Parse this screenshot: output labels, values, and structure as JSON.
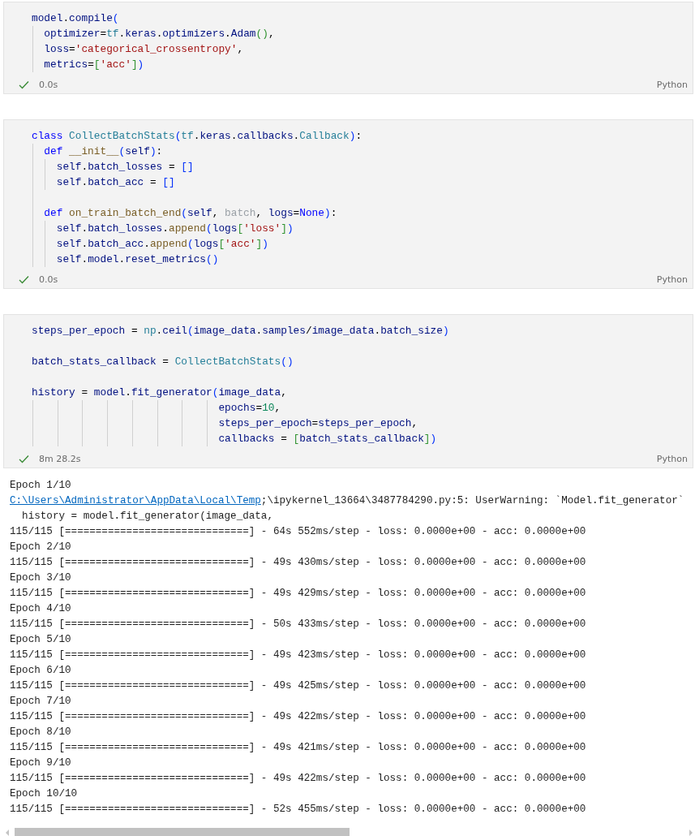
{
  "cells": [
    {
      "lines": [
        {
          "kind": "code",
          "tokens": [
            {
              "kind": "var",
              "text": "model"
            },
            {
              "kind": "plain",
              "text": "."
            },
            {
              "kind": "var",
              "text": "compile"
            },
            {
              "kind": "br1",
              "text": "("
            }
          ]
        },
        {
          "kind": "code",
          "tokens": [
            {
              "kind": "var",
              "text": "  optimizer"
            },
            {
              "kind": "plain",
              "text": "="
            },
            {
              "kind": "cls",
              "text": "tf"
            },
            {
              "kind": "plain",
              "text": "."
            },
            {
              "kind": "var",
              "text": "keras"
            },
            {
              "kind": "plain",
              "text": "."
            },
            {
              "kind": "var",
              "text": "optimizers"
            },
            {
              "kind": "plain",
              "text": "."
            },
            {
              "kind": "var",
              "text": "Adam"
            },
            {
              "kind": "br2",
              "text": "()"
            },
            {
              "kind": "plain",
              "text": ","
            }
          ]
        },
        {
          "kind": "code",
          "tokens": [
            {
              "kind": "var",
              "text": "  loss"
            },
            {
              "kind": "plain",
              "text": "="
            },
            {
              "kind": "str",
              "text": "'categorical_crossentropy'"
            },
            {
              "kind": "plain",
              "text": ","
            }
          ]
        },
        {
          "kind": "code",
          "tokens": [
            {
              "kind": "var",
              "text": "  metrics"
            },
            {
              "kind": "plain",
              "text": "="
            },
            {
              "kind": "br2",
              "text": "["
            },
            {
              "kind": "str",
              "text": "'acc'"
            },
            {
              "kind": "br2",
              "text": "]"
            },
            {
              "kind": "br1",
              "text": ")"
            }
          ]
        }
      ],
      "status": {
        "success": true,
        "time": "0.0s",
        "language": "Python"
      }
    },
    {
      "lines": [
        {
          "kind": "code",
          "tokens": [
            {
              "kind": "kw",
              "text": "class "
            },
            {
              "kind": "cls",
              "text": "CollectBatchStats"
            },
            {
              "kind": "br1",
              "text": "("
            },
            {
              "kind": "cls",
              "text": "tf"
            },
            {
              "kind": "plain",
              "text": "."
            },
            {
              "kind": "var",
              "text": "keras"
            },
            {
              "kind": "plain",
              "text": "."
            },
            {
              "kind": "var",
              "text": "callbacks"
            },
            {
              "kind": "plain",
              "text": "."
            },
            {
              "kind": "cls",
              "text": "Callback"
            },
            {
              "kind": "br1",
              "text": ")"
            },
            {
              "kind": "plain",
              "text": ":"
            }
          ]
        },
        {
          "kind": "code",
          "tokens": [
            {
              "kind": "kw",
              "text": "  def "
            },
            {
              "kind": "fn",
              "text": "__init__"
            },
            {
              "kind": "br1",
              "text": "("
            },
            {
              "kind": "var",
              "text": "self"
            },
            {
              "kind": "br1",
              "text": ")"
            },
            {
              "kind": "plain",
              "text": ":"
            }
          ]
        },
        {
          "kind": "code",
          "tokens": [
            {
              "kind": "var",
              "text": "    self"
            },
            {
              "kind": "plain",
              "text": "."
            },
            {
              "kind": "var",
              "text": "batch_losses"
            },
            {
              "kind": "plain",
              "text": " = "
            },
            {
              "kind": "br1",
              "text": "[]"
            }
          ]
        },
        {
          "kind": "code",
          "tokens": [
            {
              "kind": "var",
              "text": "    self"
            },
            {
              "kind": "plain",
              "text": "."
            },
            {
              "kind": "var",
              "text": "batch_acc"
            },
            {
              "kind": "plain",
              "text": " = "
            },
            {
              "kind": "br1",
              "text": "[]"
            }
          ]
        },
        {
          "kind": "blank"
        },
        {
          "kind": "code",
          "tokens": [
            {
              "kind": "kw",
              "text": "  def "
            },
            {
              "kind": "fn",
              "text": "on_train_batch_end"
            },
            {
              "kind": "br1",
              "text": "("
            },
            {
              "kind": "var",
              "text": "self"
            },
            {
              "kind": "plain",
              "text": ", "
            },
            {
              "kind": "unused",
              "text": "batch"
            },
            {
              "kind": "plain",
              "text": ", "
            },
            {
              "kind": "var",
              "text": "logs"
            },
            {
              "kind": "plain",
              "text": "="
            },
            {
              "kind": "kw",
              "text": "None"
            },
            {
              "kind": "br1",
              "text": ")"
            },
            {
              "kind": "plain",
              "text": ":"
            }
          ]
        },
        {
          "kind": "code",
          "tokens": [
            {
              "kind": "var",
              "text": "    self"
            },
            {
              "kind": "plain",
              "text": "."
            },
            {
              "kind": "var",
              "text": "batch_losses"
            },
            {
              "kind": "plain",
              "text": "."
            },
            {
              "kind": "fn",
              "text": "append"
            },
            {
              "kind": "br1",
              "text": "("
            },
            {
              "kind": "var",
              "text": "logs"
            },
            {
              "kind": "br2",
              "text": "["
            },
            {
              "kind": "str",
              "text": "'loss'"
            },
            {
              "kind": "br2",
              "text": "]"
            },
            {
              "kind": "br1",
              "text": ")"
            }
          ]
        },
        {
          "kind": "code",
          "tokens": [
            {
              "kind": "var",
              "text": "    self"
            },
            {
              "kind": "plain",
              "text": "."
            },
            {
              "kind": "var",
              "text": "batch_acc"
            },
            {
              "kind": "plain",
              "text": "."
            },
            {
              "kind": "fn",
              "text": "append"
            },
            {
              "kind": "br1",
              "text": "("
            },
            {
              "kind": "var",
              "text": "logs"
            },
            {
              "kind": "br2",
              "text": "["
            },
            {
              "kind": "str",
              "text": "'acc'"
            },
            {
              "kind": "br2",
              "text": "]"
            },
            {
              "kind": "br1",
              "text": ")"
            }
          ]
        },
        {
          "kind": "code",
          "tokens": [
            {
              "kind": "var",
              "text": "    self"
            },
            {
              "kind": "plain",
              "text": "."
            },
            {
              "kind": "var",
              "text": "model"
            },
            {
              "kind": "plain",
              "text": "."
            },
            {
              "kind": "var",
              "text": "reset_metrics"
            },
            {
              "kind": "br1",
              "text": "()"
            }
          ]
        }
      ],
      "status": {
        "success": true,
        "time": "0.0s",
        "language": "Python"
      }
    },
    {
      "lines": [
        {
          "kind": "code",
          "tokens": [
            {
              "kind": "var",
              "text": "steps_per_epoch"
            },
            {
              "kind": "plain",
              "text": " = "
            },
            {
              "kind": "cls",
              "text": "np"
            },
            {
              "kind": "plain",
              "text": "."
            },
            {
              "kind": "var",
              "text": "ceil"
            },
            {
              "kind": "br1",
              "text": "("
            },
            {
              "kind": "var",
              "text": "image_data"
            },
            {
              "kind": "plain",
              "text": "."
            },
            {
              "kind": "var",
              "text": "samples"
            },
            {
              "kind": "plain",
              "text": "/"
            },
            {
              "kind": "var",
              "text": "image_data"
            },
            {
              "kind": "plain",
              "text": "."
            },
            {
              "kind": "var",
              "text": "batch_size"
            },
            {
              "kind": "br1",
              "text": ")"
            }
          ]
        },
        {
          "kind": "blank"
        },
        {
          "kind": "code",
          "tokens": [
            {
              "kind": "var",
              "text": "batch_stats_callback"
            },
            {
              "kind": "plain",
              "text": " = "
            },
            {
              "kind": "cls",
              "text": "CollectBatchStats"
            },
            {
              "kind": "br1",
              "text": "()"
            }
          ]
        },
        {
          "kind": "blank"
        },
        {
          "kind": "code",
          "tokens": [
            {
              "kind": "var",
              "text": "history"
            },
            {
              "kind": "plain",
              "text": " = "
            },
            {
              "kind": "var",
              "text": "model"
            },
            {
              "kind": "plain",
              "text": "."
            },
            {
              "kind": "var",
              "text": "fit_generator"
            },
            {
              "kind": "br1",
              "text": "("
            },
            {
              "kind": "var",
              "text": "image_data"
            },
            {
              "kind": "plain",
              "text": ","
            }
          ]
        },
        {
          "kind": "code",
          "tokens": [
            {
              "kind": "var",
              "text": "                              epochs"
            },
            {
              "kind": "plain",
              "text": "="
            },
            {
              "kind": "num",
              "text": "10"
            },
            {
              "kind": "plain",
              "text": ","
            }
          ]
        },
        {
          "kind": "code",
          "tokens": [
            {
              "kind": "var",
              "text": "                              steps_per_epoch"
            },
            {
              "kind": "plain",
              "text": "="
            },
            {
              "kind": "var",
              "text": "steps_per_epoch"
            },
            {
              "kind": "plain",
              "text": ","
            }
          ]
        },
        {
          "kind": "code",
          "tokens": [
            {
              "kind": "var",
              "text": "                              callbacks"
            },
            {
              "kind": "plain",
              "text": " = "
            },
            {
              "kind": "br2",
              "text": "["
            },
            {
              "kind": "var",
              "text": "batch_stats_callback"
            },
            {
              "kind": "br2",
              "text": "]"
            },
            {
              "kind": "br1",
              "text": ")"
            }
          ]
        }
      ],
      "status": {
        "success": true,
        "time": "8m 28.2s",
        "language": "Python"
      },
      "output": [
        {
          "text": "Epoch 1/10"
        },
        {
          "link": "C:\\Users\\Administrator\\AppData\\Local\\Temp",
          "text": ";\\ipykernel_13664\\3487784290.py:5: UserWarning: `Model.fit_generator`"
        },
        {
          "text": "  history = model.fit_generator(image_data,"
        },
        {
          "text": "115/115 [==============================] - 64s 552ms/step - loss: 0.0000e+00 - acc: 0.0000e+00"
        },
        {
          "text": "Epoch 2/10"
        },
        {
          "text": "115/115 [==============================] - 49s 430ms/step - loss: 0.0000e+00 - acc: 0.0000e+00"
        },
        {
          "text": "Epoch 3/10"
        },
        {
          "text": "115/115 [==============================] - 49s 429ms/step - loss: 0.0000e+00 - acc: 0.0000e+00"
        },
        {
          "text": "Epoch 4/10"
        },
        {
          "text": "115/115 [==============================] - 50s 433ms/step - loss: 0.0000e+00 - acc: 0.0000e+00"
        },
        {
          "text": "Epoch 5/10"
        },
        {
          "text": "115/115 [==============================] - 49s 423ms/step - loss: 0.0000e+00 - acc: 0.0000e+00"
        },
        {
          "text": "Epoch 6/10"
        },
        {
          "text": "115/115 [==============================] - 49s 425ms/step - loss: 0.0000e+00 - acc: 0.0000e+00"
        },
        {
          "text": "Epoch 7/10"
        },
        {
          "text": "115/115 [==============================] - 49s 422ms/step - loss: 0.0000e+00 - acc: 0.0000e+00"
        },
        {
          "text": "Epoch 8/10"
        },
        {
          "text": "115/115 [==============================] - 49s 421ms/step - loss: 0.0000e+00 - acc: 0.0000e+00"
        },
        {
          "text": "Epoch 9/10"
        },
        {
          "text": "115/115 [==============================] - 49s 422ms/step - loss: 0.0000e+00 - acc: 0.0000e+00"
        },
        {
          "text": "Epoch 10/10"
        },
        {
          "text": "115/115 [==============================] - 52s 455ms/step - loss: 0.0000e+00 - acc: 0.0000e+00"
        }
      ]
    }
  ]
}
